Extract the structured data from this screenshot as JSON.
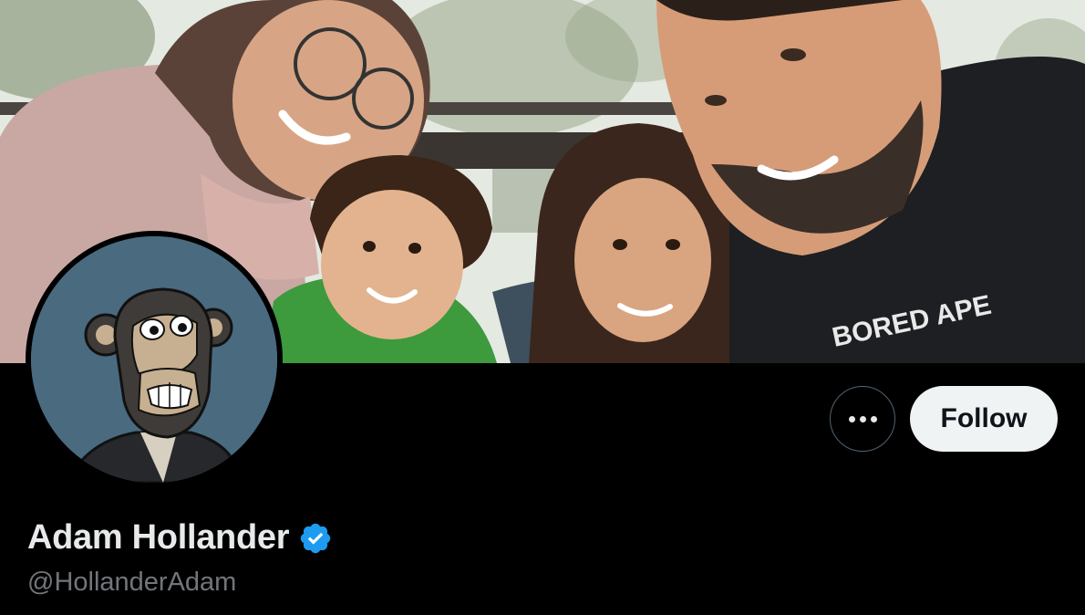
{
  "profile": {
    "display_name": "Adam Hollander",
    "handle": "@HollanderAdam",
    "verified": true
  },
  "banner": {
    "hoodie_text": "BORED APE"
  },
  "actions": {
    "follow_label": "Follow",
    "more_icon": "more-horizontal-icon"
  },
  "colors": {
    "background": "#000000",
    "follow_button_bg": "#eff3f4",
    "verified_badge": "#1d9bf0",
    "handle_text": "#71767b",
    "name_text": "#e7e9ea"
  }
}
